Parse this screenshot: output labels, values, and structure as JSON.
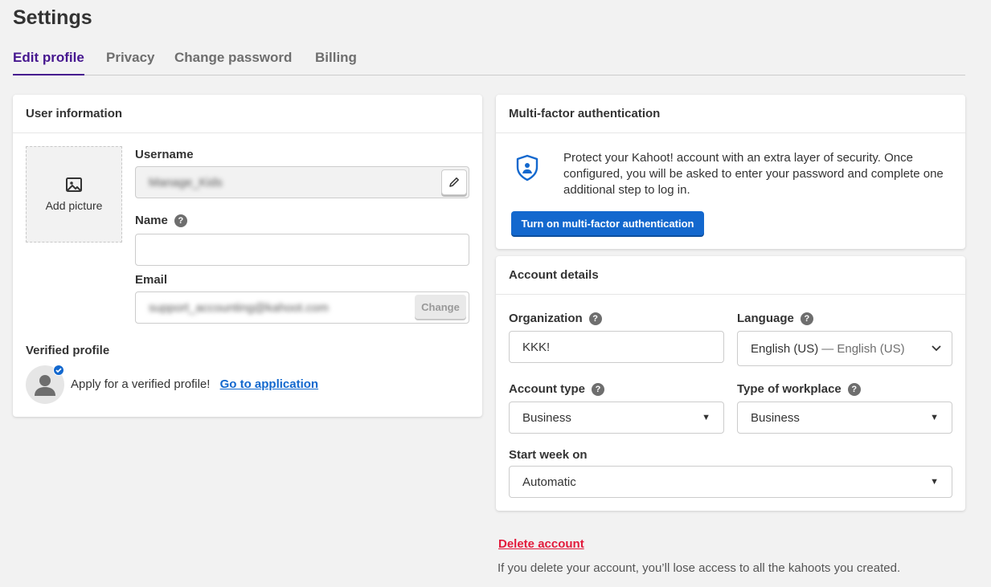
{
  "page": {
    "title": "Settings"
  },
  "tabs": [
    {
      "label": "Edit profile",
      "active": true
    },
    {
      "label": "Privacy",
      "active": false
    },
    {
      "label": "Change password",
      "active": false
    },
    {
      "label": "Billing",
      "active": false
    }
  ],
  "user_info": {
    "header": "User information",
    "add_picture_label": "Add picture",
    "username_label": "Username",
    "username_value": "Manage_Kids",
    "name_label": "Name",
    "name_value": "",
    "email_label": "Email",
    "email_value": "support_accounting@kahoot.com",
    "email_change_label": "Change",
    "verified_label": "Verified profile",
    "verified_text": "Apply for a verified profile!",
    "verified_link": "Go to application"
  },
  "mfa": {
    "header": "Multi-factor authentication",
    "description": "Protect your Kahoot! account with an extra layer of security. Once configured, you will be asked to enter your password and complete one additional step to log in.",
    "button_label": "Turn on multi-factor authentication"
  },
  "account": {
    "header": "Account details",
    "organization_label": "Organization",
    "organization_value": "KKK!",
    "language_label": "Language",
    "language_value": "English (US)",
    "language_native": "— English (US)",
    "account_type_label": "Account type",
    "account_type_value": "Business",
    "workplace_label": "Type of workplace",
    "workplace_value": "Business",
    "start_week_label": "Start week on",
    "start_week_value": "Automatic"
  },
  "delete": {
    "link_label": "Delete account",
    "warning": "If you delete your account, you’ll lose access to all the kahoots you created."
  },
  "colors": {
    "accent": "#46178f",
    "primary": "#1368ce",
    "danger": "#e21b3c"
  },
  "icons": [
    "image-icon",
    "help-icon",
    "pencil-icon",
    "shield-user-icon",
    "user-icon",
    "verified-check-icon",
    "chevron-down-icon",
    "caret-down-icon"
  ]
}
